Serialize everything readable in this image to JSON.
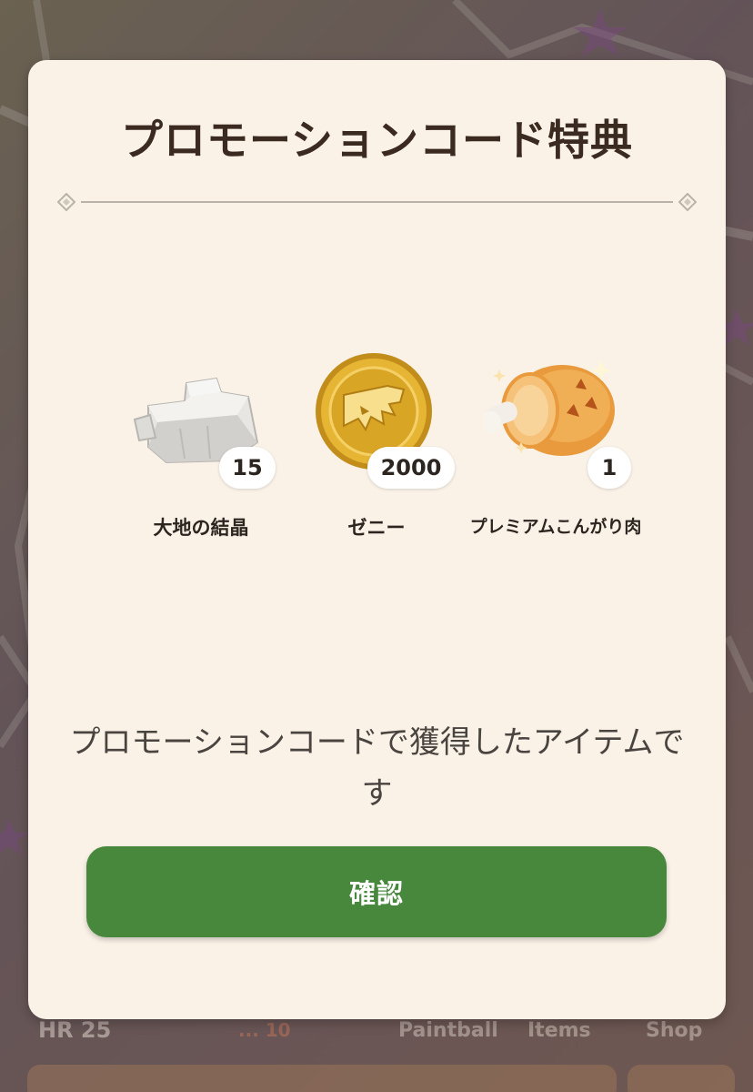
{
  "background": {
    "hunter_rank": "HR 25",
    "hunter_rank_extra": "... 10",
    "nav": [
      "Paintball",
      "Items",
      "Shop"
    ]
  },
  "dialog": {
    "title": "プロモーションコード特典",
    "rewards": [
      {
        "name": "大地の結晶",
        "count": "15",
        "icon": "earth-crystal-icon"
      },
      {
        "name": "ゼニー",
        "count": "2000",
        "icon": "zenny-coin-icon"
      },
      {
        "name": "プレミアムこんがり肉",
        "count": "1",
        "icon": "premium-well-done-steak-icon"
      }
    ],
    "message": "プロモーションコードで獲得したアイテムです",
    "confirm_label": "確認"
  },
  "colors": {
    "dialog_bg": "#faf2e7",
    "title_text": "#3b2a1f",
    "confirm_button": "#47883d",
    "coin_gold": "#d9a524",
    "meat_orange": "#e89a3c"
  }
}
